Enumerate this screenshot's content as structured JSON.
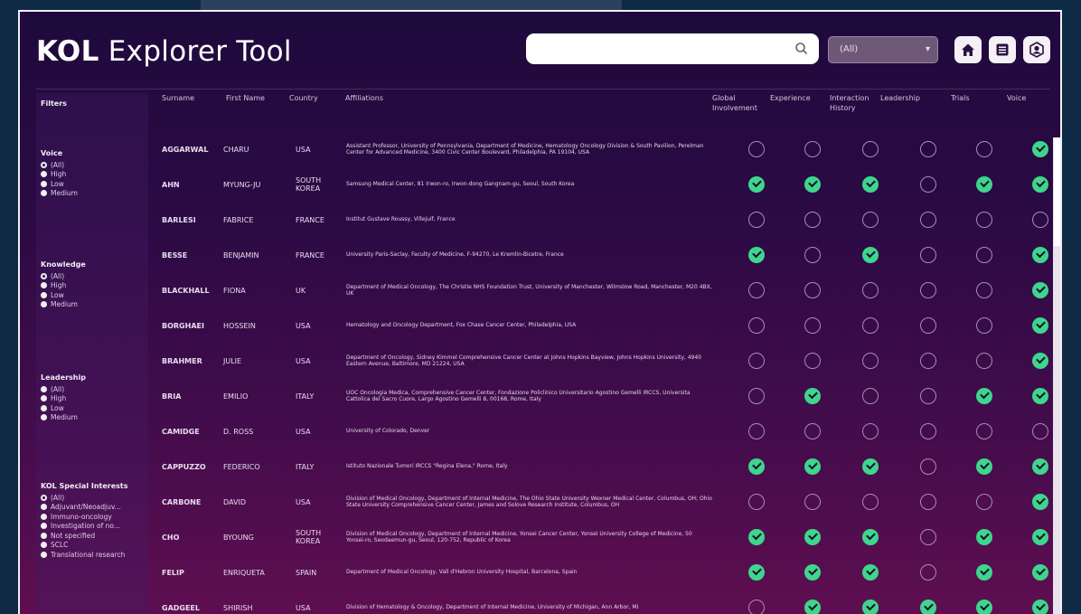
{
  "app": {
    "title_bold": "KOL",
    "title_rest": " Explorer Tool"
  },
  "toolbar": {
    "search_value": "",
    "select_value": "(All)",
    "buttons": [
      "home-icon",
      "list-icon",
      "profile-icon"
    ]
  },
  "colors": {
    "check_on": "#3dd68c",
    "check_off_border": "#a48eb4",
    "frame": "#f2eef4"
  },
  "sidebar": {
    "title": "Filters",
    "groups": [
      {
        "title": "Voice",
        "options": [
          "(All)",
          "High",
          "Low",
          "Medium"
        ],
        "selected": 0
      },
      {
        "title": "Knowledge",
        "options": [
          "(All)",
          "High",
          "Low",
          "Medium"
        ],
        "selected": 0
      },
      {
        "title": "Leadership",
        "options": [
          "(All)",
          "High",
          "Low",
          "Medium"
        ],
        "selected": 0
      },
      {
        "title": "KOL Special Interests",
        "options": [
          "(All)",
          "Adjuvant/Neoadjuv...",
          "Immuno-oncology",
          "Investigation of no...",
          "Not specified",
          "SCLC",
          "Translational research"
        ],
        "selected": 0
      }
    ]
  },
  "table": {
    "columns": [
      "Surname",
      "First Name",
      "Country",
      "Affiliations",
      "Global Involvement",
      "Experience",
      "Interaction History",
      "Leadership",
      "Trials",
      "Voice"
    ],
    "rows": [
      {
        "surname": "AGGARWAL",
        "first": "CHARU",
        "country": "USA",
        "aff": "Assistant Professor, University of Pennsylvania, Department of Medicine, Hematology Oncology Division & South Pavilion, Perelman Center for Advanced Medicine, 3400 Civic Center Boulevard, Philadelphia, PA 19104, USA",
        "flags": [
          0,
          0,
          0,
          0,
          0,
          1
        ]
      },
      {
        "surname": "AHN",
        "first": "MYUNG-JU",
        "country": "SOUTH KOREA",
        "aff": "Samsung Medical Center, 81 Irwon-ro, Irwon-dong Gangnam-gu, Seoul, South Korea",
        "flags": [
          1,
          1,
          1,
          0,
          1,
          1
        ]
      },
      {
        "surname": "BARLESI",
        "first": "FABRICE",
        "country": "FRANCE",
        "aff": "Institut Gustave Roussy, Villejuif, France",
        "flags": [
          0,
          0,
          0,
          0,
          0,
          0
        ]
      },
      {
        "surname": "BESSE",
        "first": "BENJAMIN",
        "country": "FRANCE",
        "aff": "University Paris-Saclay, Faculty of Medicine, F-94270, Le Kremlin-Bicetre, France",
        "flags": [
          1,
          0,
          1,
          0,
          0,
          1
        ]
      },
      {
        "surname": "BLACKHALL",
        "first": "FIONA",
        "country": "UK",
        "aff": "Department of Medical Oncology, The Christie NHS Foundation Trust, University of Manchester, Wilmslow Road, Manchester, M20 4BX, UK",
        "flags": [
          0,
          0,
          0,
          0,
          0,
          1
        ]
      },
      {
        "surname": "BORGHAEI",
        "first": "HOSSEIN",
        "country": "USA",
        "aff": "Hematology and Oncology Department, Fox Chase Cancer Center, Philadelphia, USA",
        "flags": [
          0,
          0,
          0,
          0,
          0,
          1
        ]
      },
      {
        "surname": "BRAHMER",
        "first": "JULIE",
        "country": "USA",
        "aff": "Department of Oncology, Sidney Kimmel Comprehensive Cancer Center at Johns Hopkins Bayview, Johns Hopkins University, 4940 Eastern Avenue, Baltimore, MD 21224, USA",
        "flags": [
          0,
          0,
          0,
          0,
          0,
          1
        ]
      },
      {
        "surname": "BRIA",
        "first": "EMILIO",
        "country": "ITALY",
        "aff": "UOC Oncologia Medica, Comprehensive Cancer Center, Fondazione Policlinico Universitario Agostino Gemelli IRCCS, Universita Cattolica del Sacro Cuore, Largo Agostino Gemelli 8, 00168, Rome, Italy",
        "flags": [
          0,
          1,
          0,
          0,
          1,
          1
        ]
      },
      {
        "surname": "CAMIDGE",
        "first": "D. ROSS",
        "country": "USA",
        "aff": "University of Colorado, Denver",
        "flags": [
          0,
          0,
          0,
          0,
          0,
          0
        ]
      },
      {
        "surname": "CAPPUZZO",
        "first": "FEDERICO",
        "country": "ITALY",
        "aff": "Istituto Nazionale Tumori IRCCS \"Regina Elena,\" Rome, Italy",
        "flags": [
          1,
          1,
          1,
          0,
          1,
          1
        ]
      },
      {
        "surname": "CARBONE",
        "first": "DAVID",
        "country": "USA",
        "aff": "Division of Medical Oncology, Department of Internal Medicine, The Ohio State University Wexner Medical Center, Columbus, OH; Ohio State University Comprehensive Cancer Center, James and Solove Research Institute, Columbus, OH",
        "flags": [
          0,
          0,
          0,
          0,
          0,
          1
        ]
      },
      {
        "surname": "CHO",
        "first": "BYOUNG",
        "country": "SOUTH KOREA",
        "aff": "Division of Medical Oncology, Department of Internal Medicine, Yonsei Cancer Center, Yonsei University College of Medicine, 50 Yonsei-ro, Seodaemun-gu, Seoul, 120-752, Republic of Korea",
        "flags": [
          1,
          1,
          1,
          0,
          1,
          1
        ]
      },
      {
        "surname": "FELIP",
        "first": "ENRIQUETA",
        "country": "SPAIN",
        "aff": "Department of Medical Oncology, Vall d'Hebron University Hospital, Barcelona, Spain",
        "flags": [
          1,
          1,
          1,
          0,
          1,
          1
        ]
      },
      {
        "surname": "GADGEEL",
        "first": "SHIRISH",
        "country": "USA",
        "aff": "Division of Hematology & Oncology, Department of Internal Medicine, University of Michigan, Ann Arbor, MI",
        "flags": [
          0,
          1,
          1,
          1,
          1,
          1
        ]
      }
    ]
  }
}
